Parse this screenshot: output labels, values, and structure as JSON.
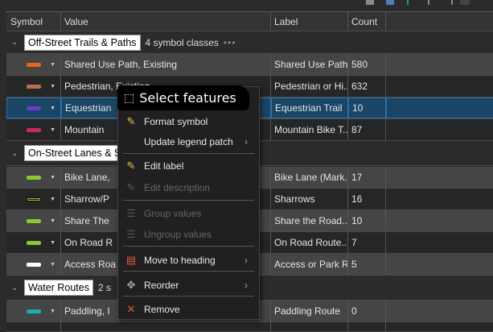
{
  "columns": [
    "Symbol",
    "Value",
    "Label",
    "Count"
  ],
  "groups": [
    {
      "name": "Off-Street Trails & Paths",
      "count_text": "4 symbol classes",
      "more": "•••",
      "rows": [
        {
          "value": "Shared Use Path, Existing",
          "label": "Shared Use Path",
          "count": "580",
          "color": "#e8641c",
          "style": "light"
        },
        {
          "value": "Pedestrian, Existing",
          "label": "Pedestrian or Hi...",
          "count": "632",
          "color": "#b8704a",
          "style": "dark"
        },
        {
          "value": "Equestrian",
          "label": "Equestrian Trail",
          "count": "10",
          "color": "#6a3cc8",
          "style": "sel"
        },
        {
          "value": "Mountain",
          "label": "Mountain Bike T...",
          "count": "87",
          "color": "#c8286a",
          "style": "dark"
        }
      ]
    },
    {
      "name": "On-Street Lanes & Sh",
      "count_text": "",
      "more": "",
      "rows": [
        {
          "value": "Bike Lane,",
          "label": "Bike Lane (Mark...",
          "count": "17",
          "color": "#8cc832",
          "style": "light"
        },
        {
          "value": "Sharrow/P",
          "label": "Sharrows",
          "count": "16",
          "color": "#111111",
          "style": "dark"
        },
        {
          "value": "Share The",
          "label": "Share the Road...",
          "count": "10",
          "color": "#8cc832",
          "style": "light"
        },
        {
          "value": "On Road R",
          "label": "On Road Route...",
          "count": "7",
          "color": "#8cc832",
          "style": "dark"
        },
        {
          "value": "Access Roa",
          "label": "Access or Park R...",
          "count": "5",
          "color": "#ffffff",
          "style": "light"
        }
      ]
    },
    {
      "name": "Water Routes",
      "count_text": "2 s",
      "more": "",
      "rows": [
        {
          "value": "Paddling, I",
          "label": "Paddling Route",
          "count": "0",
          "color": "#1ab0b0",
          "style": "light"
        }
      ]
    }
  ],
  "tooltip": "Select features",
  "menu": [
    {
      "label": "Format symbol",
      "icon": "pencil-icon",
      "disabled": false,
      "submenu": false
    },
    {
      "label": "Update legend patch",
      "icon": "",
      "disabled": false,
      "submenu": true
    },
    {
      "label": "Edit label",
      "icon": "pencil-icon",
      "disabled": false,
      "submenu": false
    },
    {
      "label": "Edit description",
      "icon": "pencil-icon",
      "disabled": true,
      "submenu": false
    },
    {
      "label": "Group values",
      "icon": "group-icon",
      "disabled": true,
      "submenu": false
    },
    {
      "label": "Ungroup values",
      "icon": "ungroup-icon",
      "disabled": true,
      "submenu": false
    },
    {
      "label": "Move to heading",
      "icon": "move-heading-icon",
      "disabled": false,
      "submenu": true
    },
    {
      "label": "Reorder",
      "icon": "reorder-icon",
      "disabled": false,
      "submenu": true
    },
    {
      "label": "Remove",
      "icon": "remove-icon",
      "disabled": false,
      "submenu": false
    }
  ]
}
